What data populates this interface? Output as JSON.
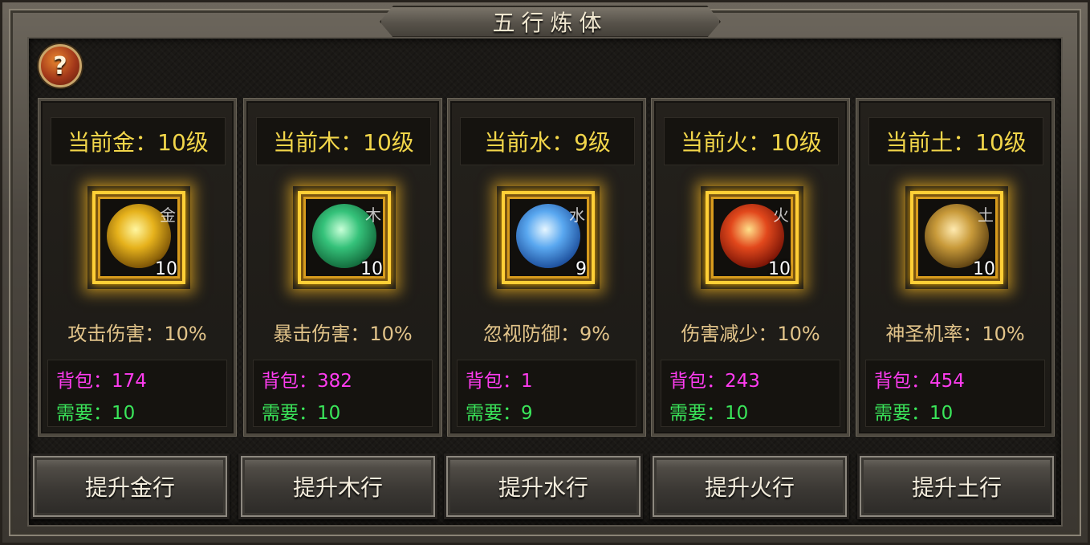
{
  "window": {
    "title": "五行炼体",
    "help_label": "?"
  },
  "elements": [
    {
      "key": "metal",
      "level_label": "当前金：10级",
      "glyph": "金",
      "count": "10",
      "effect": "攻击伤害：10%",
      "bag": "背包：174",
      "need": "需要：10",
      "button": "提升金行",
      "orb_color": "#e6b21c"
    },
    {
      "key": "wood",
      "level_label": "当前木：10级",
      "glyph": "木",
      "count": "10",
      "effect": "暴击伤害：10%",
      "bag": "背包：382",
      "need": "需要：10",
      "button": "提升木行",
      "orb_color": "#35c27a"
    },
    {
      "key": "water",
      "level_label": "当前水：9级",
      "glyph": "水",
      "count": "9",
      "effect": "忽视防御：9%",
      "bag": "背包：1",
      "need": "需要：9",
      "button": "提升水行",
      "orb_color": "#5aa8f0"
    },
    {
      "key": "fire",
      "level_label": "当前火：10级",
      "glyph": "火",
      "count": "10",
      "effect": "伤害减少：10%",
      "bag": "背包：243",
      "need": "需要：10",
      "button": "提升火行",
      "orb_color": "#e2481c"
    },
    {
      "key": "earth",
      "level_label": "当前土：10级",
      "glyph": "土",
      "count": "10",
      "effect": "神圣机率：10%",
      "bag": "背包：454",
      "need": "需要：10",
      "button": "提升土行",
      "orb_color": "#c89a3a"
    }
  ]
}
